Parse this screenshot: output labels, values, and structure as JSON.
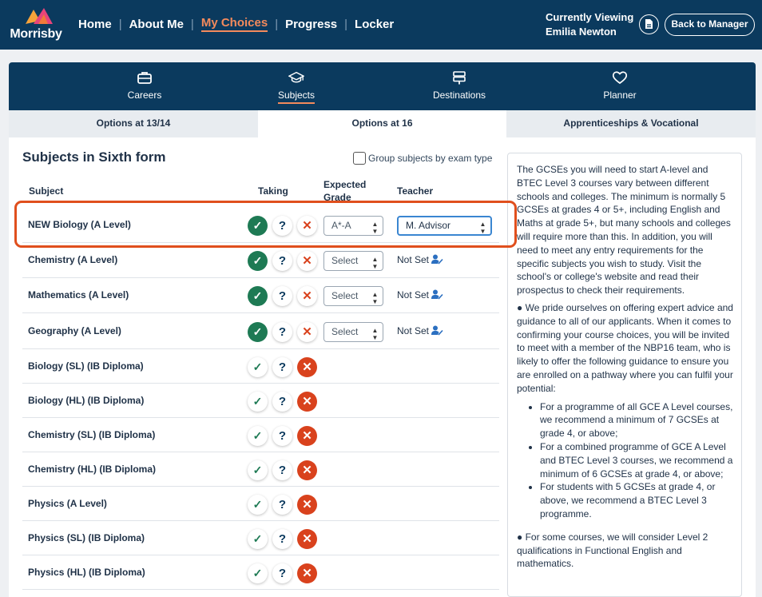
{
  "app": {
    "logo_text": "Morrisby"
  },
  "nav": {
    "items": [
      "Home",
      "About Me",
      "My Choices",
      "Progress",
      "Locker"
    ],
    "active": "My Choices"
  },
  "viewing": {
    "label": "Currently Viewing",
    "name": "Emilia Newton",
    "back_label": "Back to Manager"
  },
  "icon_tabs": [
    {
      "label": "Careers",
      "icon": "briefcase-icon"
    },
    {
      "label": "Subjects",
      "icon": "graduation-cap-icon"
    },
    {
      "label": "Destinations",
      "icon": "signpost-icon"
    },
    {
      "label": "Planner",
      "icon": "heart-icon"
    }
  ],
  "sub_tabs": [
    "Options at 13/14",
    "Options at 16",
    "Apprenticeships & Vocational"
  ],
  "section": {
    "title": "Subjects in Sixth form",
    "group_label": "Group subjects by exam type"
  },
  "columns": {
    "subject": "Subject",
    "taking": "Taking",
    "grade": "Expected Grade",
    "teacher": "Teacher"
  },
  "rows": [
    {
      "name": "NEW Biology (A Level)",
      "taking": "yes",
      "grade": "A*-A",
      "teacher": "M. Advisor"
    },
    {
      "name": "Chemistry (A Level)",
      "taking": "yes",
      "grade": "Select",
      "teacher": "Not Set"
    },
    {
      "name": "Mathematics (A Level)",
      "taking": "yes",
      "grade": "Select",
      "teacher": "Not Set"
    },
    {
      "name": "Geography (A Level)",
      "taking": "yes",
      "grade": "Select",
      "teacher": "Not Set"
    },
    {
      "name": "Biology (SL) (IB Diploma)",
      "taking": "no"
    },
    {
      "name": "Biology (HL) (IB Diploma)",
      "taking": "no"
    },
    {
      "name": "Chemistry (SL) (IB Diploma)",
      "taking": "no"
    },
    {
      "name": "Chemistry (HL) (IB Diploma)",
      "taking": "no"
    },
    {
      "name": "Physics (A Level)",
      "taking": "no"
    },
    {
      "name": "Physics (SL) (IB Diploma)",
      "taking": "no"
    },
    {
      "name": "Physics (HL) (IB Diploma)",
      "taking": "no"
    }
  ],
  "info": {
    "p1": "The GCSEs you will need to start A-level and BTEC Level 3 courses vary between different schools and colleges. The minimum is normally 5 GCSEs at grades 4 or 5+, including English and Maths at grade 5+, but many schools and colleges will require more than this. In addition, you will need to meet any entry requirements for the specific subjects you wish to study. Visit the school's or college's website and read their prospectus to check their requirements.",
    "p2": "● We pride ourselves on offering expert advice and guidance to all of our applicants. When it comes to confirming your course choices, you will be invited to meet with a member of the NBP16 team, who is likely to offer the following guidance to ensure you are enrolled on a pathway where you can fulfil your potential:",
    "bullets": [
      "For a programme of all GCE A Level courses, we recommend a minimum of 7 GCSEs at grade 4, or above;",
      "For a combined programme of GCE A Level and BTEC Level 3 courses, we recommend a minimum of 6 GCSEs at grade 4, or above;",
      "For students with 5 GCSEs at grade 4, or above, we recommend a BTEC Level 3 programme."
    ],
    "p3": "● For some courses, we will consider Level 2 qualifications in Functional English and mathematics."
  },
  "colors": {
    "navy": "#0b3a5e",
    "accent": "#f38a5c",
    "green": "#1e7a54",
    "red": "#d9421d",
    "highlight": "#e04f1d"
  }
}
